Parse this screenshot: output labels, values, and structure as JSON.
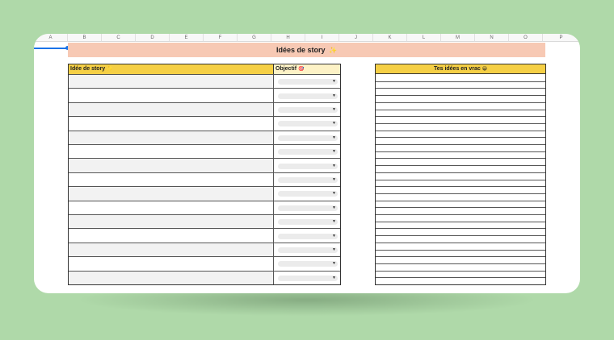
{
  "columns": [
    "A",
    "B",
    "C",
    "D",
    "E",
    "F",
    "G",
    "H",
    "I",
    "J",
    "K",
    "L",
    "M",
    "N",
    "O",
    "P"
  ],
  "banner": {
    "title": "Idées de story",
    "emoji": "✨"
  },
  "left_table": {
    "headers": {
      "story": "Idée de story",
      "story_emoji": "✨",
      "objective": "Objectif",
      "objective_emoji": "🎯"
    },
    "rows": 15,
    "dropdown_arrow": "▼"
  },
  "right_table": {
    "header": "Tes idées en vrac",
    "header_emoji": "😁",
    "lines": 30
  },
  "colors": {
    "background": "#afd9a9",
    "banner": "#f7c9b4",
    "header_yellow": "#f5cf45",
    "header_light": "#fdf2c6",
    "selection": "#1a73e8"
  }
}
